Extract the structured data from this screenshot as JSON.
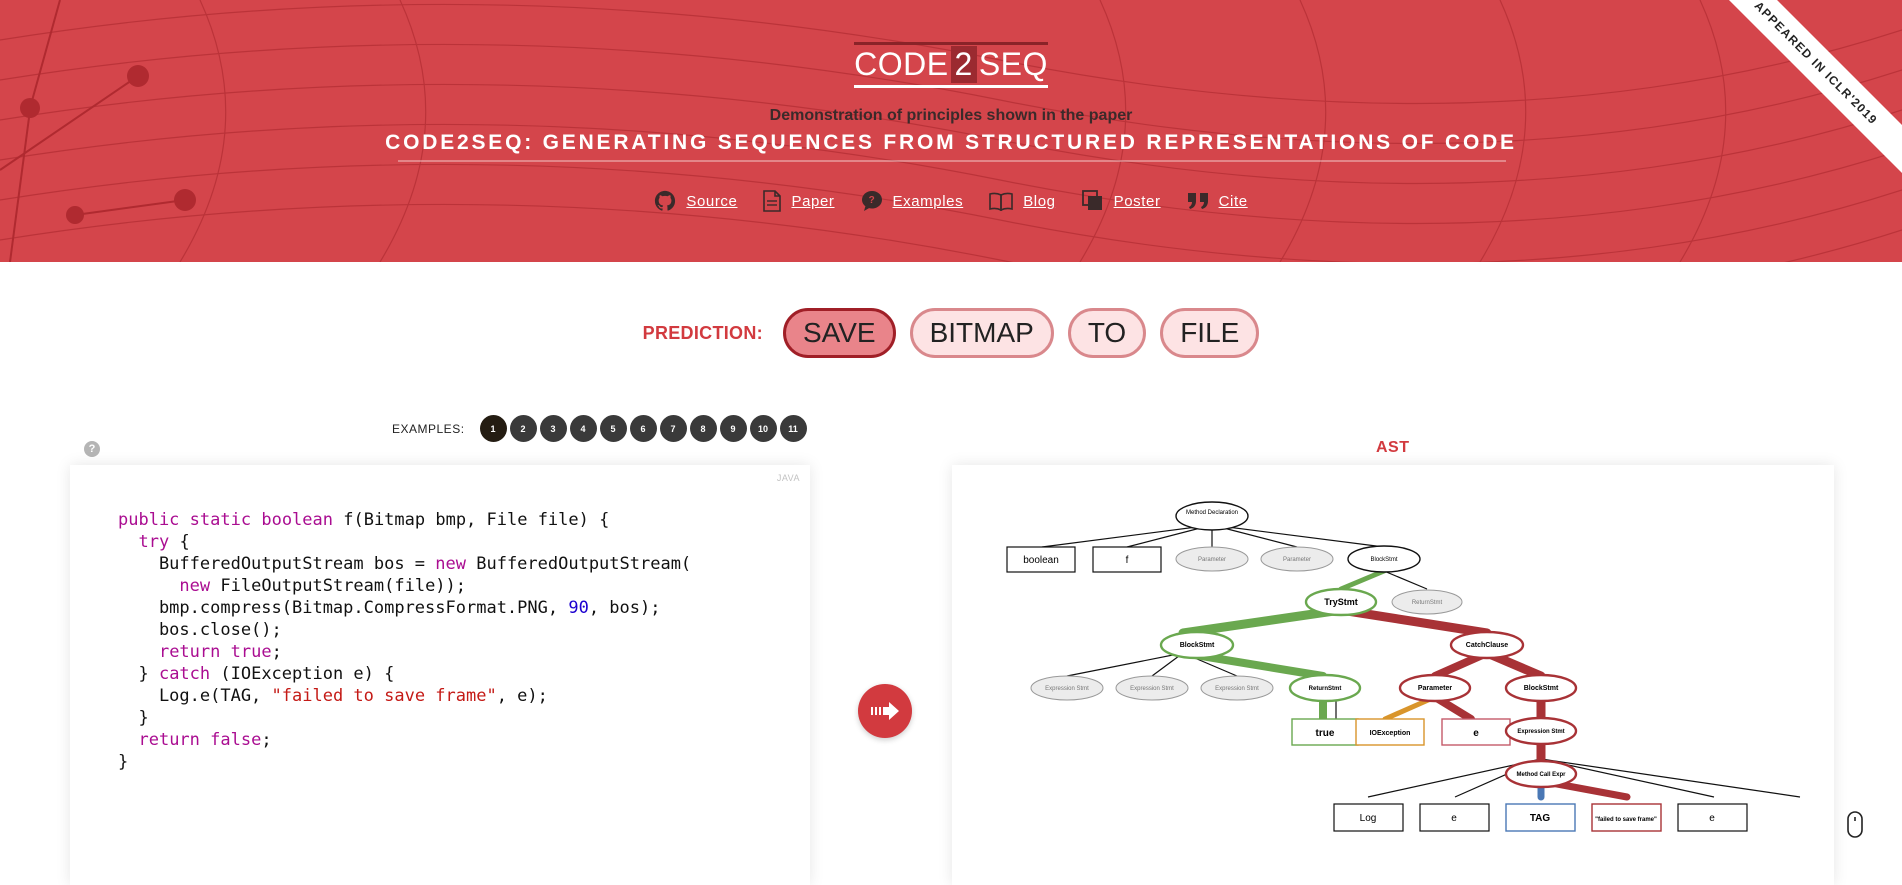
{
  "header": {
    "logo_left": "CODE",
    "logo_mid": "2",
    "logo_right": "SEQ",
    "subtitle": "Demonstration of principles shown in the paper",
    "title": "CODE2SEQ: GENERATING SEQUENCES FROM STRUCTURED REPRESENTATIONS OF CODE",
    "ribbon": "APPEARED IN ICLR'2019",
    "links": [
      {
        "label": "Source",
        "icon": "github-icon"
      },
      {
        "label": "Paper",
        "icon": "document-icon"
      },
      {
        "label": "Examples",
        "icon": "chat-icon"
      },
      {
        "label": "Blog",
        "icon": "book-icon"
      },
      {
        "label": "Poster",
        "icon": "copy-icon"
      },
      {
        "label": "Cite",
        "icon": "quote-icon"
      }
    ]
  },
  "prediction": {
    "label": "PREDICTION:",
    "tokens": [
      "SAVE",
      "BITMAP",
      "TO",
      "FILE"
    ],
    "active_index": 0
  },
  "examples": {
    "label": "EXAMPLES:",
    "items": [
      "1",
      "2",
      "3",
      "4",
      "5",
      "6",
      "7",
      "8",
      "9",
      "10",
      "11"
    ],
    "active_index": 0
  },
  "help_label": "?",
  "code_panel": {
    "language": "JAVA",
    "lines": [
      "public static boolean f(Bitmap bmp, File file) {",
      "  try {",
      "    BufferedOutputStream bos = new BufferedOutputStream(",
      "      new FileOutputStream(file));",
      "    bmp.compress(Bitmap.CompressFormat.PNG, 90, bos);",
      "    bos.close();",
      "    return true;",
      "  } catch (IOException e) {",
      "    Log.e(TAG, \"failed to save frame\", e);",
      "  }",
      "  return false;",
      "}"
    ]
  },
  "ast": {
    "title": "AST",
    "nodes": {
      "method_decl": "Method Declaration",
      "boolean": "boolean",
      "f": "f",
      "param1": "Parameter",
      "param2": "Parameter",
      "block_top": "BlockStmt",
      "try": "TryStmt",
      "return_top": "ReturnStmt",
      "block_try": "BlockStmt",
      "catch": "CatchClause",
      "expr1": "Expression Stmt",
      "expr2": "Expression Stmt",
      "expr3": "Expression Stmt",
      "return_try": "ReturnStmt",
      "parameter": "Parameter",
      "block_catch": "BlockStmt",
      "true": "true",
      "ioexception": "IOException",
      "e1": "e",
      "expr_catch": "Expression Stmt",
      "method_call": "Method Call Expr",
      "log": "Log",
      "e2": "e",
      "tag": "TAG",
      "msg": "\"failed to save frame\"",
      "e3": "e"
    },
    "colors": {
      "green": "#6aa84f",
      "red": "#a83236",
      "orange": "#d9952b",
      "blue": "#4a78b5"
    }
  }
}
